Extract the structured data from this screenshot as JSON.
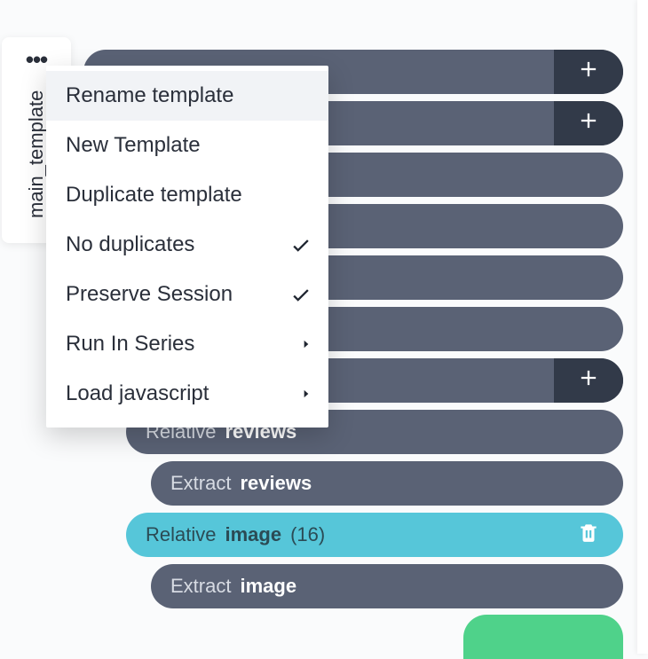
{
  "sidebar": {
    "dots": "•••",
    "label": "main_template"
  },
  "menu": {
    "items": [
      {
        "label": "Rename template",
        "check": false,
        "submenu": false,
        "highlight": true
      },
      {
        "label": "New Template",
        "check": false,
        "submenu": false,
        "highlight": false
      },
      {
        "label": "Duplicate template",
        "check": false,
        "submenu": false,
        "highlight": false
      },
      {
        "label": "No duplicates",
        "check": true,
        "submenu": false,
        "highlight": false
      },
      {
        "label": "Preserve Session",
        "check": true,
        "submenu": false,
        "highlight": false
      },
      {
        "label": "Run In Series",
        "check": false,
        "submenu": true,
        "highlight": false
      },
      {
        "label": "Load javascript",
        "check": false,
        "submenu": true,
        "highlight": false
      }
    ]
  },
  "rows": [
    {
      "indent": 0,
      "action": "",
      "target": "",
      "count": "",
      "plus": true,
      "selected": false,
      "trash": false
    },
    {
      "indent": 0,
      "action": "",
      "target": "",
      "count": "",
      "plus": true,
      "selected": false,
      "trash": false
    },
    {
      "indent": 0,
      "action": "",
      "target": "",
      "count": "",
      "plus": false,
      "selected": false,
      "trash": false
    },
    {
      "indent": 0,
      "action": "",
      "target": "",
      "count": "",
      "plus": false,
      "selected": false,
      "trash": false
    },
    {
      "indent": 0,
      "action": "",
      "target": "",
      "count": "",
      "plus": false,
      "selected": false,
      "trash": false
    },
    {
      "indent": 0,
      "action": "",
      "target": "",
      "count": "",
      "plus": false,
      "selected": false,
      "trash": false
    },
    {
      "indent": 0,
      "action": "",
      "target": "",
      "count": "",
      "plus": true,
      "selected": false,
      "trash": false
    },
    {
      "indent": 1,
      "action": "Relative",
      "target": "reviews",
      "count": "",
      "plus": false,
      "selected": false,
      "trash": false
    },
    {
      "indent": 2,
      "action": "Extract",
      "target": "reviews",
      "count": "",
      "plus": false,
      "selected": false,
      "trash": false
    },
    {
      "indent": 1,
      "action": "Relative",
      "target": "image",
      "count": "(16)",
      "plus": false,
      "selected": true,
      "trash": true
    },
    {
      "indent": 2,
      "action": "Extract",
      "target": "image",
      "count": "",
      "plus": false,
      "selected": false,
      "trash": false
    }
  ]
}
